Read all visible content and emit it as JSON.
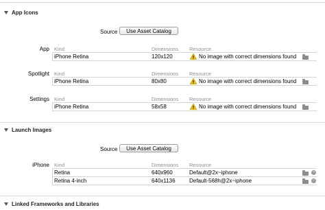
{
  "app_icons": {
    "header": "App Icons",
    "source_label": "Source",
    "source_button": "Use Asset Catalog",
    "col_kind": "Kind",
    "col_dimensions": "Dimensions",
    "col_resource": "Resource",
    "groups": [
      {
        "label": "App",
        "kind": "iPhone Retina",
        "dimensions": "120x120",
        "resource": "No image with correct dimensions found"
      },
      {
        "label": "Spotlight",
        "kind": "iPhone Retina",
        "dimensions": "80x80",
        "resource": "No image with correct dimensions found"
      },
      {
        "label": "Settings",
        "kind": "iPhone Retina",
        "dimensions": "58x58",
        "resource": "No image with correct dimensions found"
      }
    ]
  },
  "launch_images": {
    "header": "Launch Images",
    "source_label": "Source",
    "source_button": "Use Asset Catalog",
    "group_label": "iPhone",
    "col_kind": "Kind",
    "col_dimensions": "Dimensions",
    "col_resource": "Resource",
    "rows": [
      {
        "kind": "Retina",
        "dimensions": "640x960",
        "resource": "Default@2x~iphone"
      },
      {
        "kind": "Retina 4-inch",
        "dimensions": "640x1136",
        "resource": "Default-568h@2x~iphone"
      }
    ]
  },
  "linked_frameworks": {
    "header": "Linked Frameworks and Libraries"
  },
  "colors": {
    "warning": "#f5c400",
    "divider": "#dcdcdc",
    "column_header": "#8e8e8e"
  }
}
